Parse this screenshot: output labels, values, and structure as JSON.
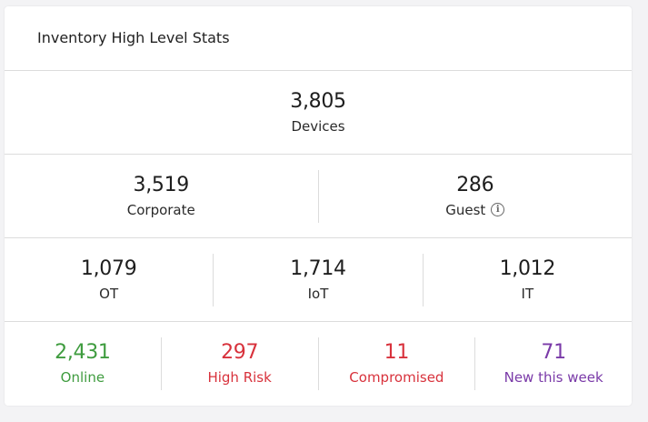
{
  "card": {
    "title": "Inventory High Level Stats"
  },
  "total": {
    "value": "3,805",
    "label": "Devices"
  },
  "segments": [
    {
      "value": "3,519",
      "label": "Corporate"
    },
    {
      "value": "286",
      "label": "Guest",
      "icon": "info-icon"
    }
  ],
  "categories": [
    {
      "value": "1,079",
      "label": "OT"
    },
    {
      "value": "1,714",
      "label": "IoT"
    },
    {
      "value": "1,012",
      "label": "IT"
    }
  ],
  "status": [
    {
      "value": "2,431",
      "label": "Online",
      "color": "#3f9c3f"
    },
    {
      "value": "297",
      "label": "High Risk",
      "color": "#d8323c"
    },
    {
      "value": "11",
      "label": "Compromised",
      "color": "#d8323c"
    },
    {
      "value": "71",
      "label": "New this week",
      "color": "#7a3aa8"
    }
  ]
}
